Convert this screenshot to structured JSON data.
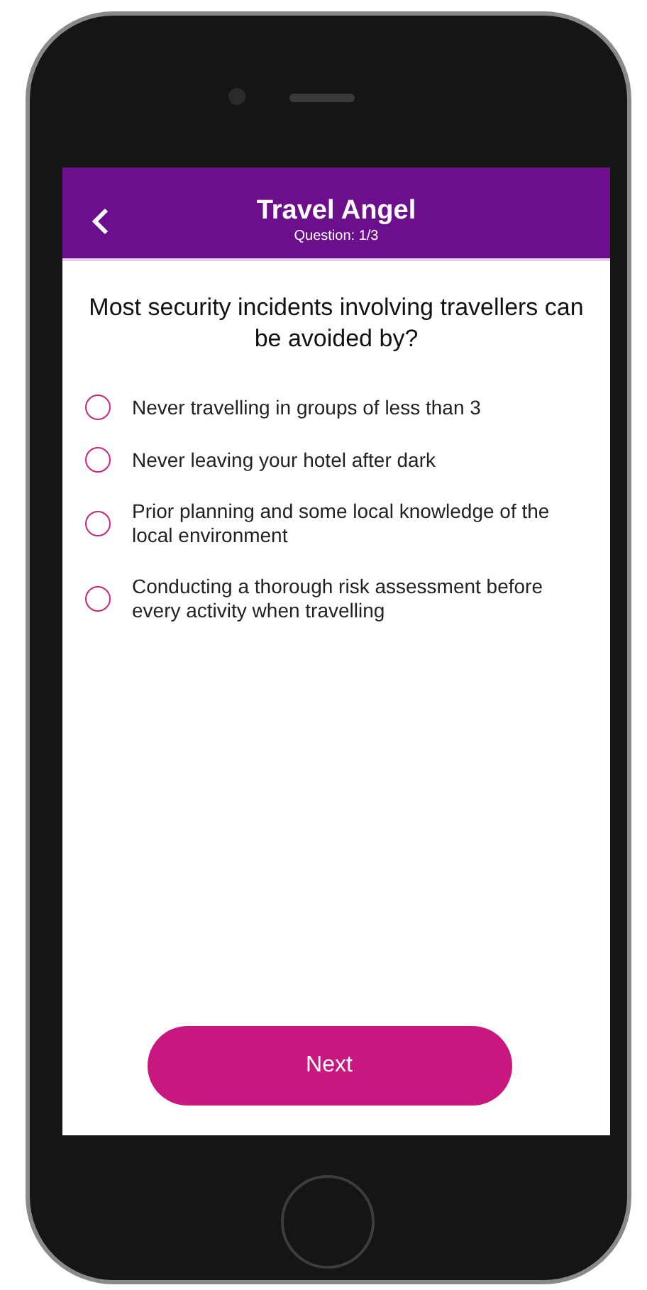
{
  "header": {
    "title": "Travel Angel",
    "subtitle": "Question: 1/3"
  },
  "question": "Most security incidents involving travellers can be avoided by?",
  "options": [
    {
      "label": "Never travelling in groups of less than 3",
      "selected": false
    },
    {
      "label": "Never leaving your hotel after dark",
      "selected": false
    },
    {
      "label": "Prior planning and some local knowledge of the local environment",
      "selected": false
    },
    {
      "label": "Conducting a thorough risk assessment before every activity when travelling",
      "selected": false
    }
  ],
  "next_button": "Next"
}
